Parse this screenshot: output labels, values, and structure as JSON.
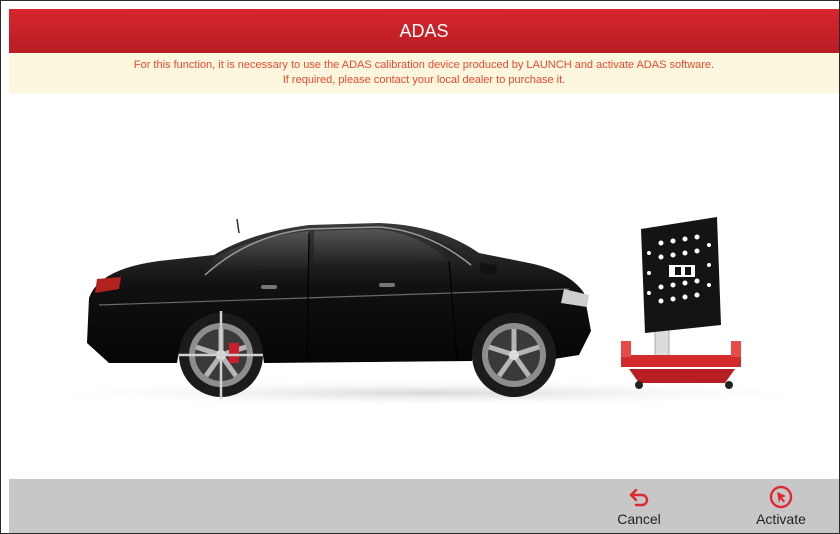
{
  "header": {
    "title": "ADAS"
  },
  "notice": {
    "line1": "For this function, it is necessary to use the ADAS calibration device produced by LAUNCH  and activate ADAS software.",
    "line2": "If required, please contact your local dealer to purchase it."
  },
  "toolbar": {
    "cancel_label": "Cancel",
    "activate_label": "Activate"
  },
  "colors": {
    "accent": "#d7262e",
    "notice_text": "#e64c2e",
    "notice_bg": "#fdf6df",
    "toolbar_bg": "#c7c7c7"
  }
}
